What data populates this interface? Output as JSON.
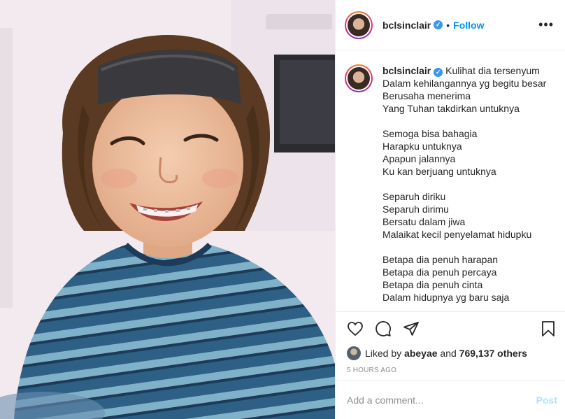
{
  "post": {
    "author": "bclsinclair",
    "verified_icon": "verified-badge-icon",
    "header_dot": "•",
    "follow_label": "Follow",
    "more_label": "•••"
  },
  "caption": {
    "author": "bclsinclair",
    "first_line": "Kulihat dia tersenyum",
    "lines": [
      "Dalam kehilangannya yg begitu besar",
      "Berusaha menerima",
      "Yang Tuhan takdirkan untuknya",
      "",
      "Semoga bisa bahagia",
      "Harapku untuknya",
      "Apapun jalannya",
      "Ku kan berjuang untuknya",
      "",
      "Separuh diriku",
      "Separuh dirimu",
      "Bersatu dalam jiwa",
      "Malaikat kecil penyelamat hidupku",
      "",
      "Betapa dia penuh harapan",
      "Betapa dia penuh percaya",
      "Betapa dia penuh cinta",
      "Dalam hidupnya yg baru saja"
    ]
  },
  "actions": {
    "like_icon": "heart-icon",
    "comment_icon": "comment-icon",
    "share_icon": "share-icon",
    "save_icon": "bookmark-icon"
  },
  "likes": {
    "prefix": "Liked by",
    "user": "abeyae",
    "conjunction": "and",
    "count": "769,137 others"
  },
  "timestamp": "5 HOURS AGO",
  "comment": {
    "placeholder": "Add a comment...",
    "post_label": "Post"
  },
  "colors": {
    "accent": "#0095f6",
    "post_disabled": "#b2dffc",
    "muted": "#8e8e8e",
    "verified": "#3897f0"
  }
}
